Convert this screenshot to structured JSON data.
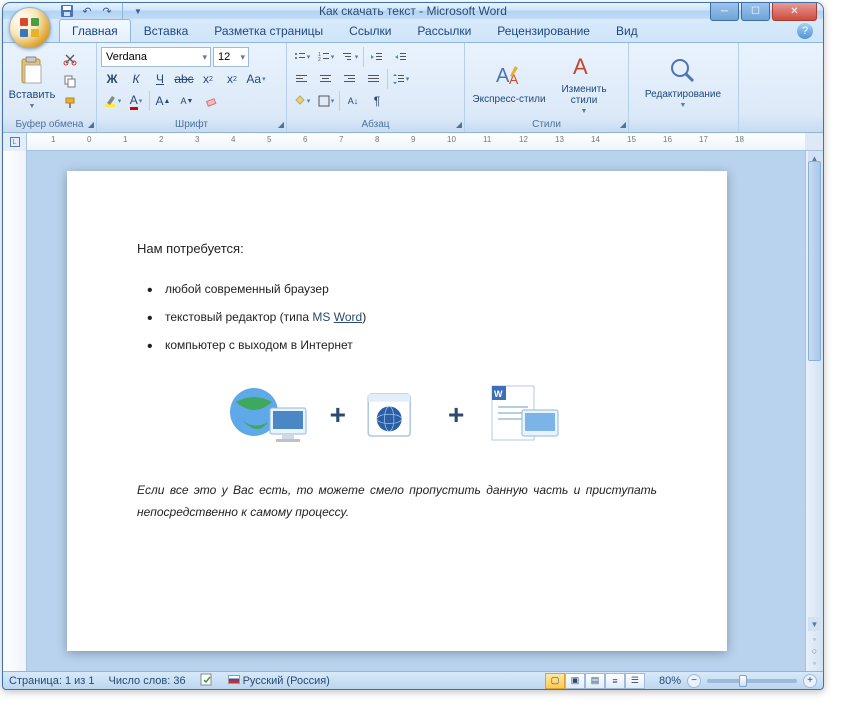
{
  "title": "Как скачать текст - Microsoft Word",
  "tabs": [
    "Главная",
    "Вставка",
    "Разметка страницы",
    "Ссылки",
    "Рассылки",
    "Рецензирование",
    "Вид"
  ],
  "active_tab": 0,
  "ribbon": {
    "clipboard": {
      "label": "Буфер обмена",
      "paste": "Вставить"
    },
    "font": {
      "label": "Шрифт",
      "name": "Verdana",
      "size": "12"
    },
    "paragraph": {
      "label": "Абзац"
    },
    "styles": {
      "label": "Стили",
      "quick": "Экспресс-стили",
      "change": "Изменить стили"
    },
    "editing": {
      "label": "Редактирование"
    }
  },
  "document": {
    "heading": "Нам потребуется:",
    "bullets": [
      "любой современный браузер",
      "текстовый редактор (типа MS Word)",
      "компьютер с выходом в Интернет"
    ],
    "ms_prefix": "MS ",
    "word_underlined": "Word",
    "italic": "Если все это у Вас есть, то можете смело пропустить данную часть и приступать непосредственно к самому процессу."
  },
  "status": {
    "page": "Страница: 1 из 1",
    "words": "Число слов: 36",
    "lang": "Русский (Россия)",
    "zoom": "80%"
  }
}
